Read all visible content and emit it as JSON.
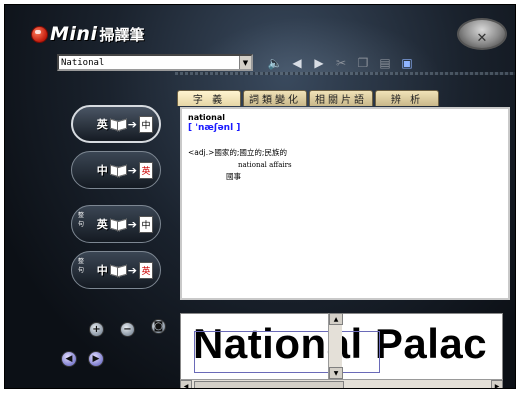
{
  "app": {
    "logo_text": "Mini",
    "logo_cjk": "掃譯筆"
  },
  "search": {
    "value": "National"
  },
  "toolbar": {
    "buttons": [
      {
        "icon": "speaker-icon"
      },
      {
        "icon": "back-arrow-icon"
      },
      {
        "icon": "forward-arrow-icon"
      },
      {
        "icon": "scissors-icon"
      },
      {
        "icon": "copy-icon"
      },
      {
        "icon": "paste-icon"
      },
      {
        "icon": "help-window-icon"
      }
    ]
  },
  "tabs": [
    {
      "label": "字 義"
    },
    {
      "label": "詞類變化"
    },
    {
      "label": "相關片語"
    },
    {
      "label": "辨 析"
    }
  ],
  "entry": {
    "word": "national",
    "phonetic": "[ 'næʃənl ]",
    "sense": "<adj.>國家的;國立的;民族的",
    "example_en": "national affairs",
    "example_zh": "國事"
  },
  "modes": [
    {
      "from": "英",
      "to": "中",
      "side": ""
    },
    {
      "from": "中",
      "to": "英",
      "side": ""
    },
    {
      "from": "英",
      "to": "中",
      "side": "整句"
    },
    {
      "from": "中",
      "to": "英",
      "side": "整句"
    }
  ],
  "preview": {
    "text": "National Palac"
  },
  "colors": {
    "accent_blue": "#1a1aff",
    "tab_bg": "#e6d6a6"
  }
}
